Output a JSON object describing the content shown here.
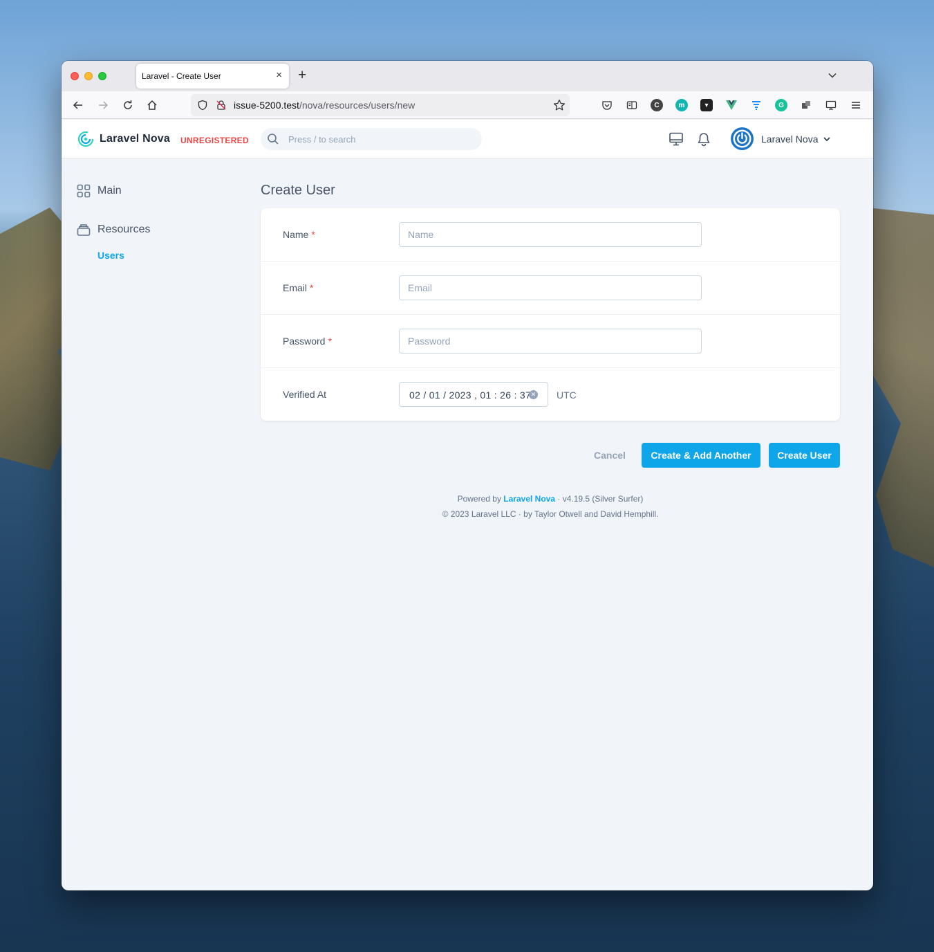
{
  "browser": {
    "tab_title": "Laravel - Create User",
    "tab_close": "×",
    "new_tab": "+",
    "url_host": "issue-5200.test",
    "url_path": "/nova/resources/users/new"
  },
  "header": {
    "brand": "Laravel Nova",
    "badge": "UNREGISTERED",
    "search_placeholder": "Press / to search",
    "user_name": "Laravel Nova"
  },
  "sidebar": {
    "items": [
      {
        "label": "Main"
      },
      {
        "label": "Resources"
      }
    ],
    "sub_items": [
      {
        "label": "Users"
      }
    ]
  },
  "main": {
    "title": "Create User",
    "fields": [
      {
        "label": "Name",
        "required": "*",
        "placeholder": "Name"
      },
      {
        "label": "Email",
        "required": "*",
        "placeholder": "Email"
      },
      {
        "label": "Password",
        "required": "*",
        "placeholder": "Password"
      },
      {
        "label": "Verified At",
        "value": "02 / 01 / 2023 ,  01 : 26 : 37",
        "timezone": "UTC"
      }
    ],
    "actions": {
      "cancel": "Cancel",
      "create_another": "Create & Add Another",
      "create": "Create User"
    }
  },
  "footer": {
    "powered_by": "Powered by",
    "nova_link": "Laravel Nova",
    "version": "· v4.19.5 (Silver Surfer)",
    "copyright": "© 2023 Laravel LLC · by Taylor Otwell and David Hemphill."
  },
  "colors": {
    "accent": "#0ea5e9",
    "danger": "#ef4444",
    "background": "#f1f4f8"
  }
}
